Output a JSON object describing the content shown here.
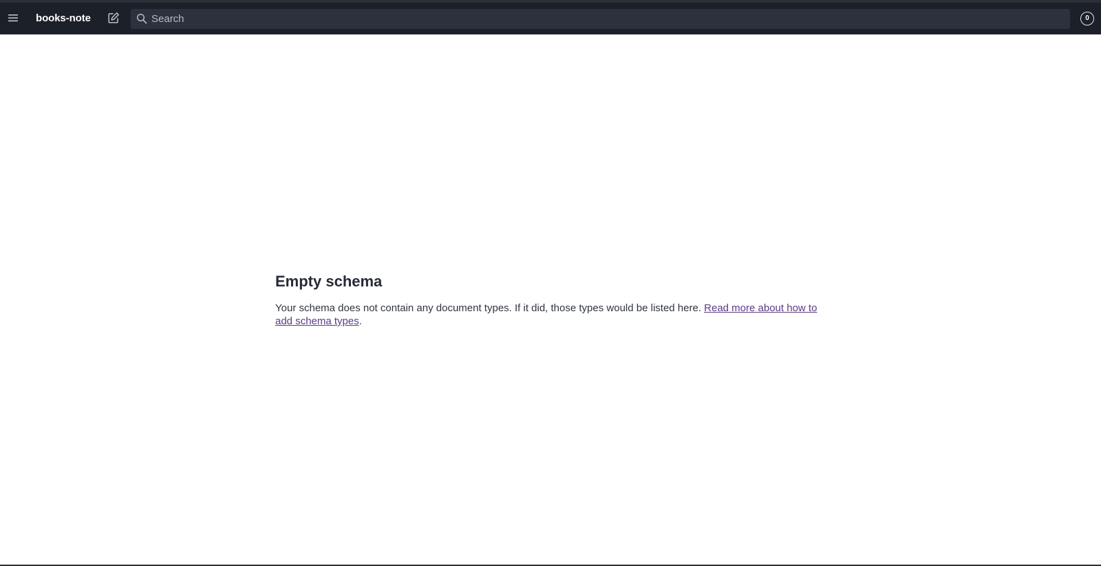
{
  "header": {
    "menu_icon": "hamburger-menu-icon",
    "project_title": "books-note",
    "compose_icon": "compose-icon",
    "search": {
      "icon": "search-icon",
      "placeholder": "Search",
      "value": ""
    },
    "avatar_label": "0"
  },
  "main": {
    "title": "Empty schema",
    "description_before_link": "Your schema does not contain any document types. If it did, those types would be listed here. ",
    "link_text": "Read more about how to add schema types",
    "description_after_link": "."
  },
  "colors": {
    "topbar_background": "#1c2029",
    "search_background": "#2c323d",
    "link_color": "#5b3a86",
    "title_color": "#262b36"
  }
}
